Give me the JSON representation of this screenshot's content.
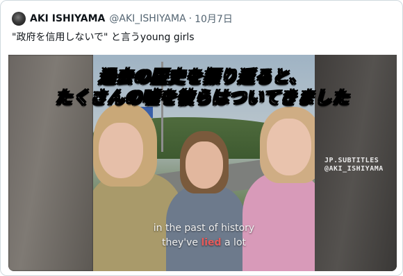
{
  "tweet": {
    "author_name": "AKI ISHIYAMA",
    "author_handle": "@AKI_ISHIYAMA",
    "separator": "·",
    "date": "10月7日",
    "text": "\"政府を信用しないで\" と言うyoung girls"
  },
  "video": {
    "subtitle_jp_line1": "過去の歴史を振り返ると、",
    "subtitle_jp_line2": "たくさんの嘘を彼らはついてきました",
    "subtitle_en_line1": "in the past of history",
    "subtitle_en_line2_pre": "they've ",
    "subtitle_en_line2_highlight": "lied",
    "subtitle_en_line2_post": " a lot",
    "watermark_line1": "JP.SUBTITLES",
    "watermark_line2": "@AKI_ISHIYAMA",
    "highlight_color": "#e65b5b"
  }
}
